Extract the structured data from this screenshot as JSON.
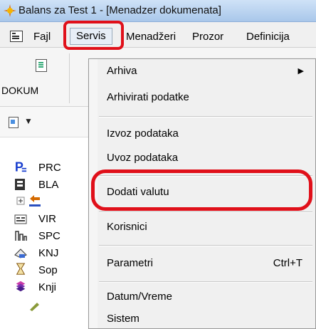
{
  "window": {
    "title": "Balans za Test 1 - [Menadzer dokumenata]"
  },
  "menubar": {
    "items": [
      "Fajl",
      "Servis",
      "Menadžeri",
      "Prozor",
      "Definicija"
    ]
  },
  "toolbar": {
    "dokum_label": "DOKUM"
  },
  "tree": {
    "items": [
      "PRC",
      "BLA",
      "",
      "VIR",
      "SPC",
      "KNJ",
      "Sop",
      "Knji"
    ]
  },
  "servis_menu": {
    "items": [
      {
        "label": "Arhiva"
      },
      {
        "label": "Arhivirati podatke"
      },
      {
        "label": "Izvoz podataka"
      },
      {
        "label": "Uvoz podataka"
      },
      {
        "label": "Dodati valutu"
      },
      {
        "label": "Korisnici"
      },
      {
        "label": "Parametri",
        "shortcut": "Ctrl+T"
      },
      {
        "label": "Datum/Vreme"
      },
      {
        "label": "Sistem"
      }
    ]
  },
  "colors": {
    "highlight": "#e0101a",
    "titlebar": "#bcd4f0"
  }
}
